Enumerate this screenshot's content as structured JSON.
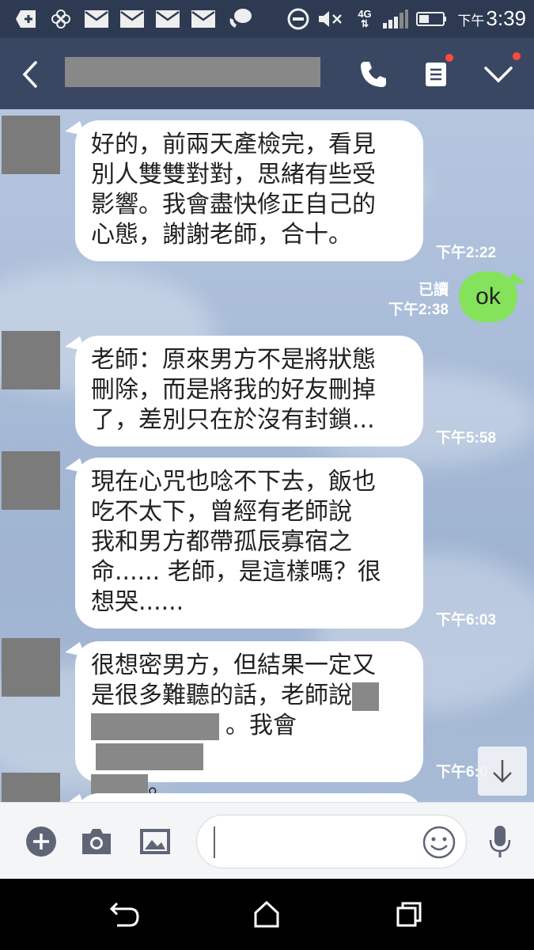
{
  "status_bar": {
    "network": "4G",
    "time_period": "下午",
    "time": "3:39",
    "icons": [
      "add-box-icon",
      "flower-icon",
      "mail-icon",
      "mail-icon",
      "mail-icon",
      "mail-icon",
      "chat-bubble-phone-icon",
      "do-not-disturb-icon",
      "mute-icon",
      "signal-icon",
      "battery-icon"
    ]
  },
  "header": {
    "back_icon": "chevron-left-icon",
    "call_icon": "phone-icon",
    "notes_icon": "notes-icon",
    "menu_icon": "chevron-down-icon",
    "notification_dot_color": "#ff4a3d"
  },
  "messages": [
    {
      "direction": "incoming",
      "text_lines": [
        "好的，前兩天產檢完，看見",
        "別人雙雙對對，思緒有些受",
        "影響。我會盡快修正自己的",
        "心態，謝謝老師，合十。"
      ],
      "time": "下午2:22"
    },
    {
      "direction": "outgoing",
      "text": "ok",
      "status": "已讀",
      "time": "下午2:38"
    },
    {
      "direction": "incoming",
      "text_lines": [
        "老師：原來男方不是將狀態",
        "刪除，而是將我的好友刪掉",
        "了，差別只在於沒有封鎖..."
      ],
      "time": "下午5:58"
    },
    {
      "direction": "incoming",
      "text_lines": [
        "現在心咒也唸不下去，飯也",
        "吃不太下，曾經有老師說",
        "我和男方都帶孤辰寡宿之",
        "命...... 老師，是這樣嗎？很",
        "想哭......"
      ],
      "time": "下午6:03"
    },
    {
      "direction": "incoming",
      "text_lines": [
        "很想密男方，但結果一定又",
        "是很多難聽的話，老師說",
        "。我會",
        "。"
      ],
      "time": "下午6:0"
    }
  ],
  "input": {
    "placeholder": "",
    "value": ""
  },
  "colors": {
    "header_bg": "#3a4763",
    "status_bg": "#2d3a52",
    "sent_bubble": "#85e25b",
    "received_bubble": "#ffffff",
    "chat_bg": "#a9bcd8"
  }
}
